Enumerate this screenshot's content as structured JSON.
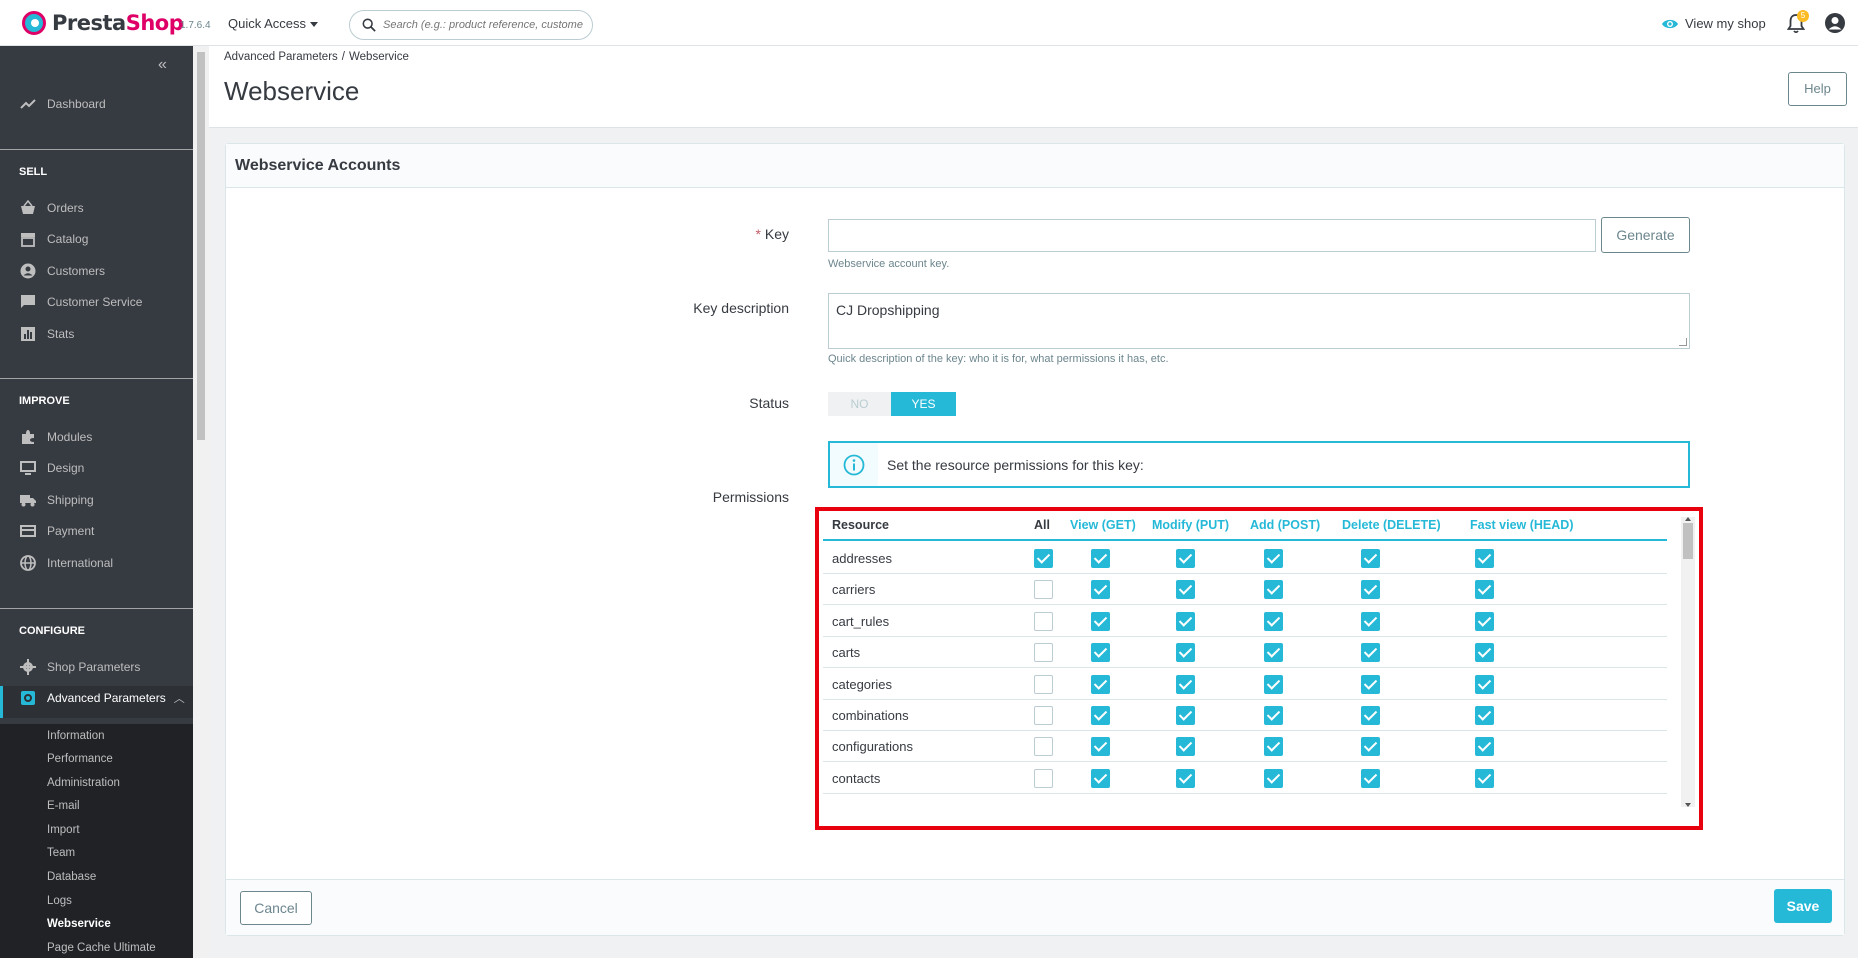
{
  "header": {
    "logo_text_a": "Presta",
    "logo_text_b": "Shop",
    "version": "1.7.6.4",
    "quick_access": "Quick Access",
    "search_placeholder": "Search (e.g.: product reference, custome",
    "view_shop": "View my shop",
    "notifications_count": "5"
  },
  "sidebar": {
    "dashboard": "Dashboard",
    "sell_title": "SELL",
    "sell_items": [
      "Orders",
      "Catalog",
      "Customers",
      "Customer Service",
      "Stats"
    ],
    "improve_title": "IMPROVE",
    "improve_items": [
      "Modules",
      "Design",
      "Shipping",
      "Payment",
      "International"
    ],
    "configure_title": "CONFIGURE",
    "configure_items": [
      "Shop Parameters",
      "Advanced Parameters"
    ],
    "sub_items": [
      "Information",
      "Performance",
      "Administration",
      "E-mail",
      "Import",
      "Team",
      "Database",
      "Logs",
      "Webservice",
      "Page Cache Ultimate"
    ]
  },
  "page": {
    "breadcrumb": [
      "Advanced Parameters",
      "Webservice"
    ],
    "title": "Webservice",
    "help": "Help"
  },
  "form": {
    "card_title": "Webservice Accounts",
    "key_required": "*",
    "key_label": "Key",
    "key_value": "",
    "generate": "Generate",
    "key_help": "Webservice account key.",
    "desc_label": "Key description",
    "desc_value": "CJ Dropshipping",
    "desc_help": "Quick description of the key: who it is for, what permissions it has, etc.",
    "status_label": "Status",
    "status_no": "NO",
    "status_yes": "YES",
    "info_text": "Set the resource permissions for this key:",
    "permissions_label": "Permissions",
    "cancel": "Cancel",
    "save": "Save"
  },
  "permissions": {
    "columns": [
      "Resource",
      "All",
      "View (GET)",
      "Modify (PUT)",
      "Add (POST)",
      "Delete (DELETE)",
      "Fast view (HEAD)"
    ],
    "rows": [
      {
        "name": "addresses",
        "checks": [
          true,
          true,
          true,
          true,
          true,
          true
        ]
      },
      {
        "name": "carriers",
        "checks": [
          false,
          true,
          true,
          true,
          true,
          true
        ]
      },
      {
        "name": "cart_rules",
        "checks": [
          false,
          true,
          true,
          true,
          true,
          true
        ]
      },
      {
        "name": "carts",
        "checks": [
          false,
          true,
          true,
          true,
          true,
          true
        ]
      },
      {
        "name": "categories",
        "checks": [
          false,
          true,
          true,
          true,
          true,
          true
        ]
      },
      {
        "name": "combinations",
        "checks": [
          false,
          true,
          true,
          true,
          true,
          true
        ]
      },
      {
        "name": "configurations",
        "checks": [
          false,
          true,
          true,
          true,
          true,
          true
        ]
      },
      {
        "name": "contacts",
        "checks": [
          false,
          true,
          true,
          true,
          true,
          true
        ]
      }
    ]
  },
  "colors": {
    "accent": "#25b9d7",
    "sidebar_bg": "#363a41",
    "highlight_frame": "#e8000e",
    "brand_pink": "#df0067"
  }
}
